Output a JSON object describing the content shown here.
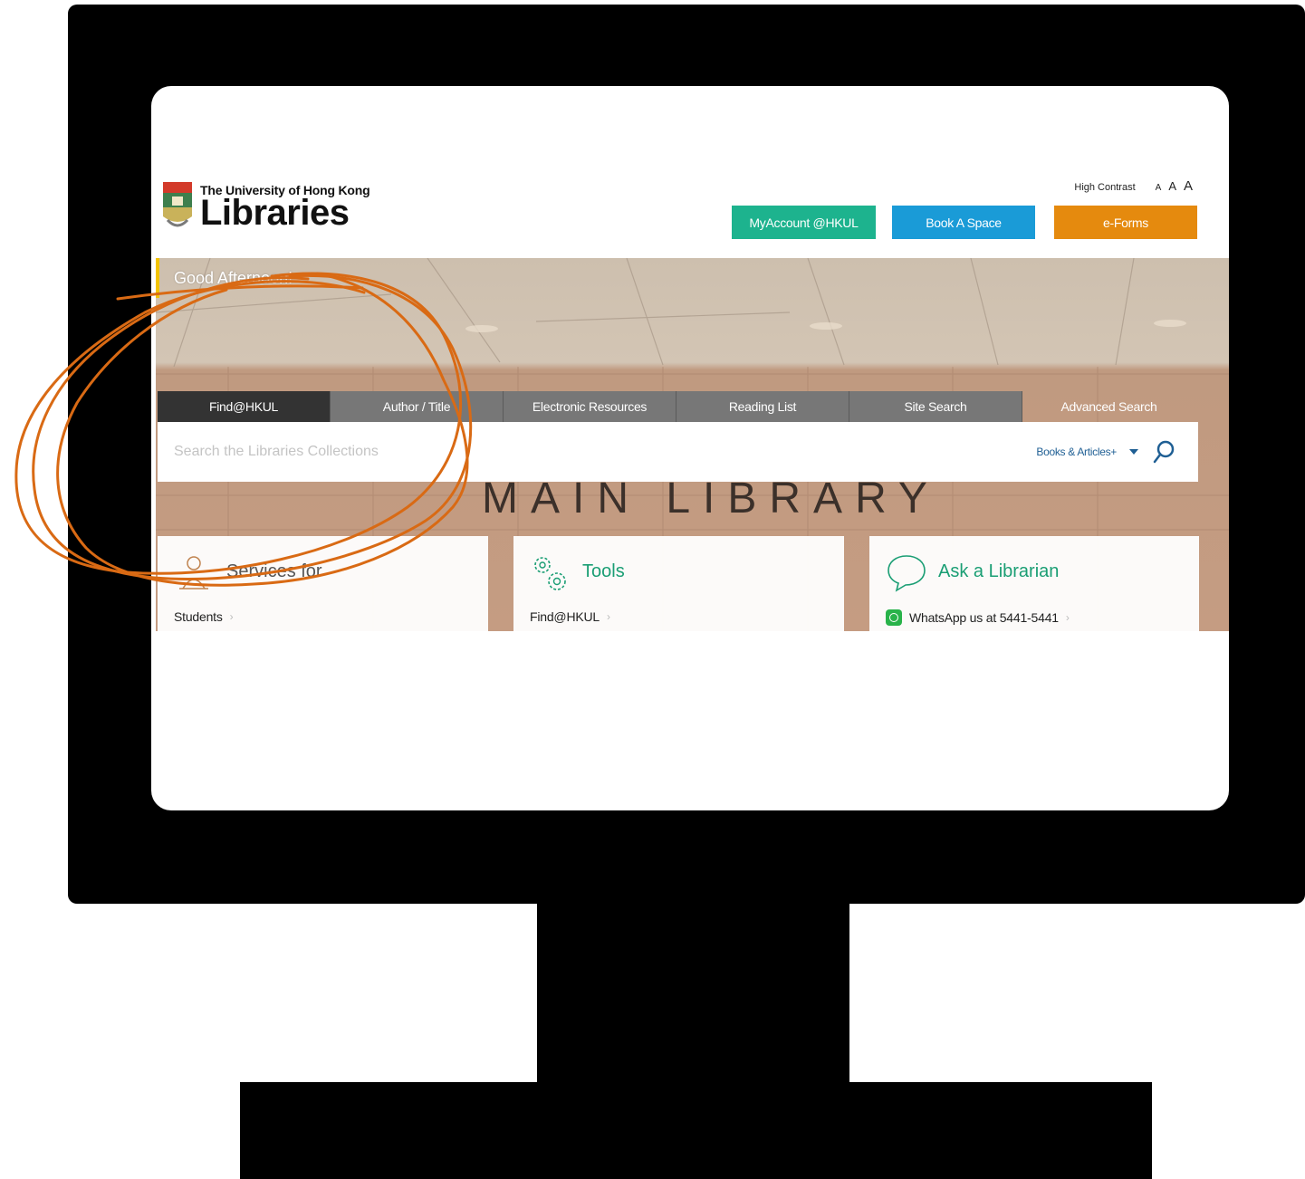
{
  "header": {
    "logo_line1": "The University of Hong Kong",
    "logo_line2": "Libraries",
    "accessibility": {
      "high_contrast": "High Contrast",
      "font_small": "A",
      "font_medium": "A",
      "font_large": "A"
    },
    "buttons": {
      "my_account": "MyAccount @HKUL",
      "book_space": "Book A Space",
      "eforms": "e-Forms"
    }
  },
  "hero": {
    "greeting": "Good Afternoon!",
    "wall_text": "MAIN LIBRARY"
  },
  "search": {
    "tabs": [
      "Find@HKUL",
      "Author / Title",
      "Electronic Resources",
      "Reading List",
      "Site Search"
    ],
    "advanced": "Advanced Search",
    "placeholder": "Search the Libraries Collections",
    "scope": "Books & Articles+"
  },
  "cards": [
    {
      "title": "Services for",
      "icon": "person-reading-icon",
      "link": "Students"
    },
    {
      "title": "Tools",
      "icon": "gears-icon",
      "link": "Find@HKUL"
    },
    {
      "title": "Ask a Librarian",
      "icon": "chat-bubble-icon",
      "link": "WhatsApp us at 5441-5441"
    }
  ],
  "colors": {
    "my_account": "#1db38e",
    "book_space": "#1a9bd7",
    "eforms": "#e58a0e",
    "tab_active": "#333333",
    "tab_inactive": "#777777",
    "accent_green": "#1a9e74",
    "annotation": "#d96a14"
  }
}
